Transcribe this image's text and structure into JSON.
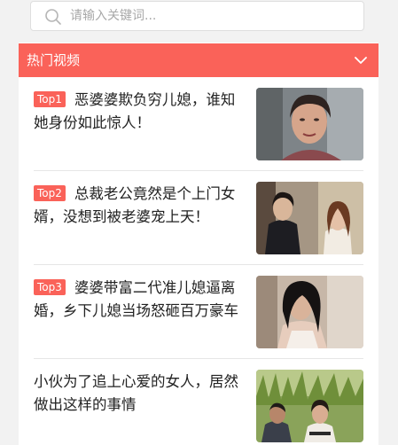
{
  "search": {
    "placeholder": "请输入关键词..."
  },
  "section": {
    "title": "热门视频"
  },
  "videos": [
    {
      "badge": "Top1",
      "title": "恶婆婆欺负穷儿媳，谁知她身份如此惊人！",
      "thumb_icon": "woman-portrait"
    },
    {
      "badge": "Top2",
      "title": "总裁老公竟然是个上门女婿，没想到被老婆宠上天！",
      "thumb_icon": "couple-scene"
    },
    {
      "badge": "Top3",
      "title": "婆婆带富二代准儿媳逼离婚，乡下儿媳当场怒砸百万豪车",
      "thumb_icon": "woman-scene"
    },
    {
      "badge": "",
      "title": "小伙为了追上心爱的女人，居然做出这样的事情",
      "thumb_icon": "field-scene"
    }
  ]
}
